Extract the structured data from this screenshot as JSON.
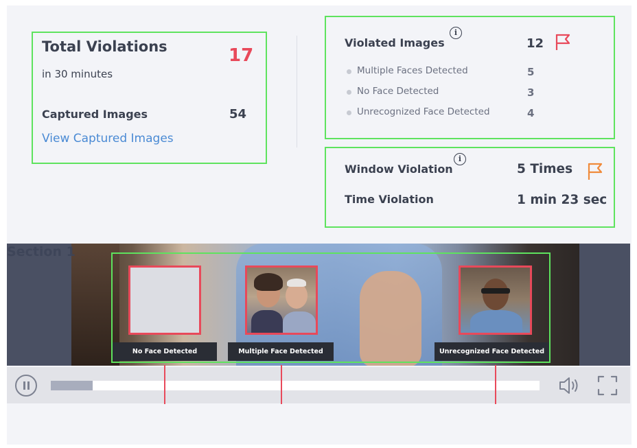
{
  "summary": {
    "total_label": "Total Violations",
    "total_value": "17",
    "period": "in 30 minutes",
    "captured_label": "Captured Images",
    "captured_value": "54",
    "view_link": "View Captured Images"
  },
  "violated": {
    "label": "Violated Images",
    "value": "12",
    "items": [
      {
        "label": "Multiple Faces Detected",
        "value": "5"
      },
      {
        "label": "No Face Detected",
        "value": "3"
      },
      {
        "label": "Unrecognized Face Detected",
        "value": "4"
      }
    ]
  },
  "window": {
    "label": "Window Violation",
    "value": "5 Times",
    "time_label": "Time Violation",
    "time_value": "1 min 23 sec"
  },
  "video": {
    "section_label": "Section 1",
    "captions": [
      "No Face Detected",
      "Multiple Face Detected",
      "Unrecognized Face Detected"
    ],
    "progress_percent": 8.5
  },
  "colors": {
    "accent_red": "#e8495a",
    "flag_orange": "#f08a3a",
    "highlight_green": "#5ee35e",
    "link_blue": "#4a8ad4"
  },
  "icons": [
    "info-icon",
    "flag-icon",
    "pause-icon",
    "volume-icon",
    "fullscreen-icon"
  ]
}
